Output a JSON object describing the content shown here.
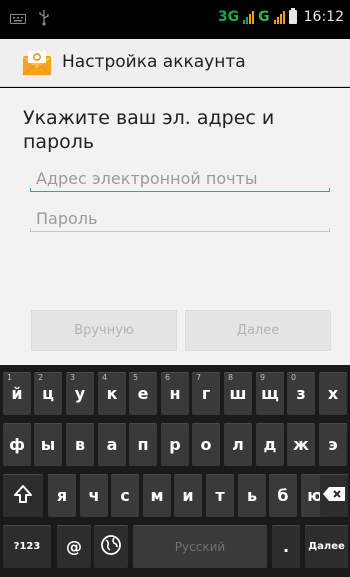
{
  "status_bar": {
    "left_icons": [
      "keyboard-icon",
      "usb-icon"
    ],
    "network_3g": "3G",
    "network_g": "G",
    "time": "16:12"
  },
  "action_bar": {
    "app_icon": "email-envelope-icon",
    "title": "Настройка аккаунта"
  },
  "form": {
    "heading": "Укажите ваш эл. адрес и пароль",
    "email": {
      "value": "",
      "placeholder": "Адрес электронной почты"
    },
    "password": {
      "value": "",
      "placeholder": "Пароль"
    },
    "manual_button": "Вручную",
    "next_button": "Далее"
  },
  "keyboard": {
    "row1": [
      {
        "label": "й",
        "hint": "1"
      },
      {
        "label": "ц",
        "hint": "2"
      },
      {
        "label": "у",
        "hint": "3"
      },
      {
        "label": "к",
        "hint": "4"
      },
      {
        "label": "е",
        "hint": "5"
      },
      {
        "label": "н",
        "hint": "6"
      },
      {
        "label": "г",
        "hint": "7"
      },
      {
        "label": "ш",
        "hint": "8"
      },
      {
        "label": "щ",
        "hint": "9"
      },
      {
        "label": "з",
        "hint": "0"
      },
      {
        "label": "х",
        "hint": ""
      }
    ],
    "row2": [
      "ф",
      "ы",
      "в",
      "а",
      "п",
      "р",
      "о",
      "л",
      "д",
      "ж",
      "э"
    ],
    "row3": [
      "я",
      "ч",
      "с",
      "м",
      "и",
      "т",
      "ь",
      "б",
      "ю"
    ],
    "shift_icon": "shift-icon",
    "backspace_icon": "backspace-icon",
    "symbols_key": "?123",
    "at_key": "@",
    "globe_icon": "globe-icon",
    "space_label": "Русский",
    "period_key": ".",
    "enter_key": "Далее"
  },
  "colors": {
    "accent": "#2b9fd9",
    "network_green": "#32b54a",
    "signal_orange": "#f0a020"
  }
}
